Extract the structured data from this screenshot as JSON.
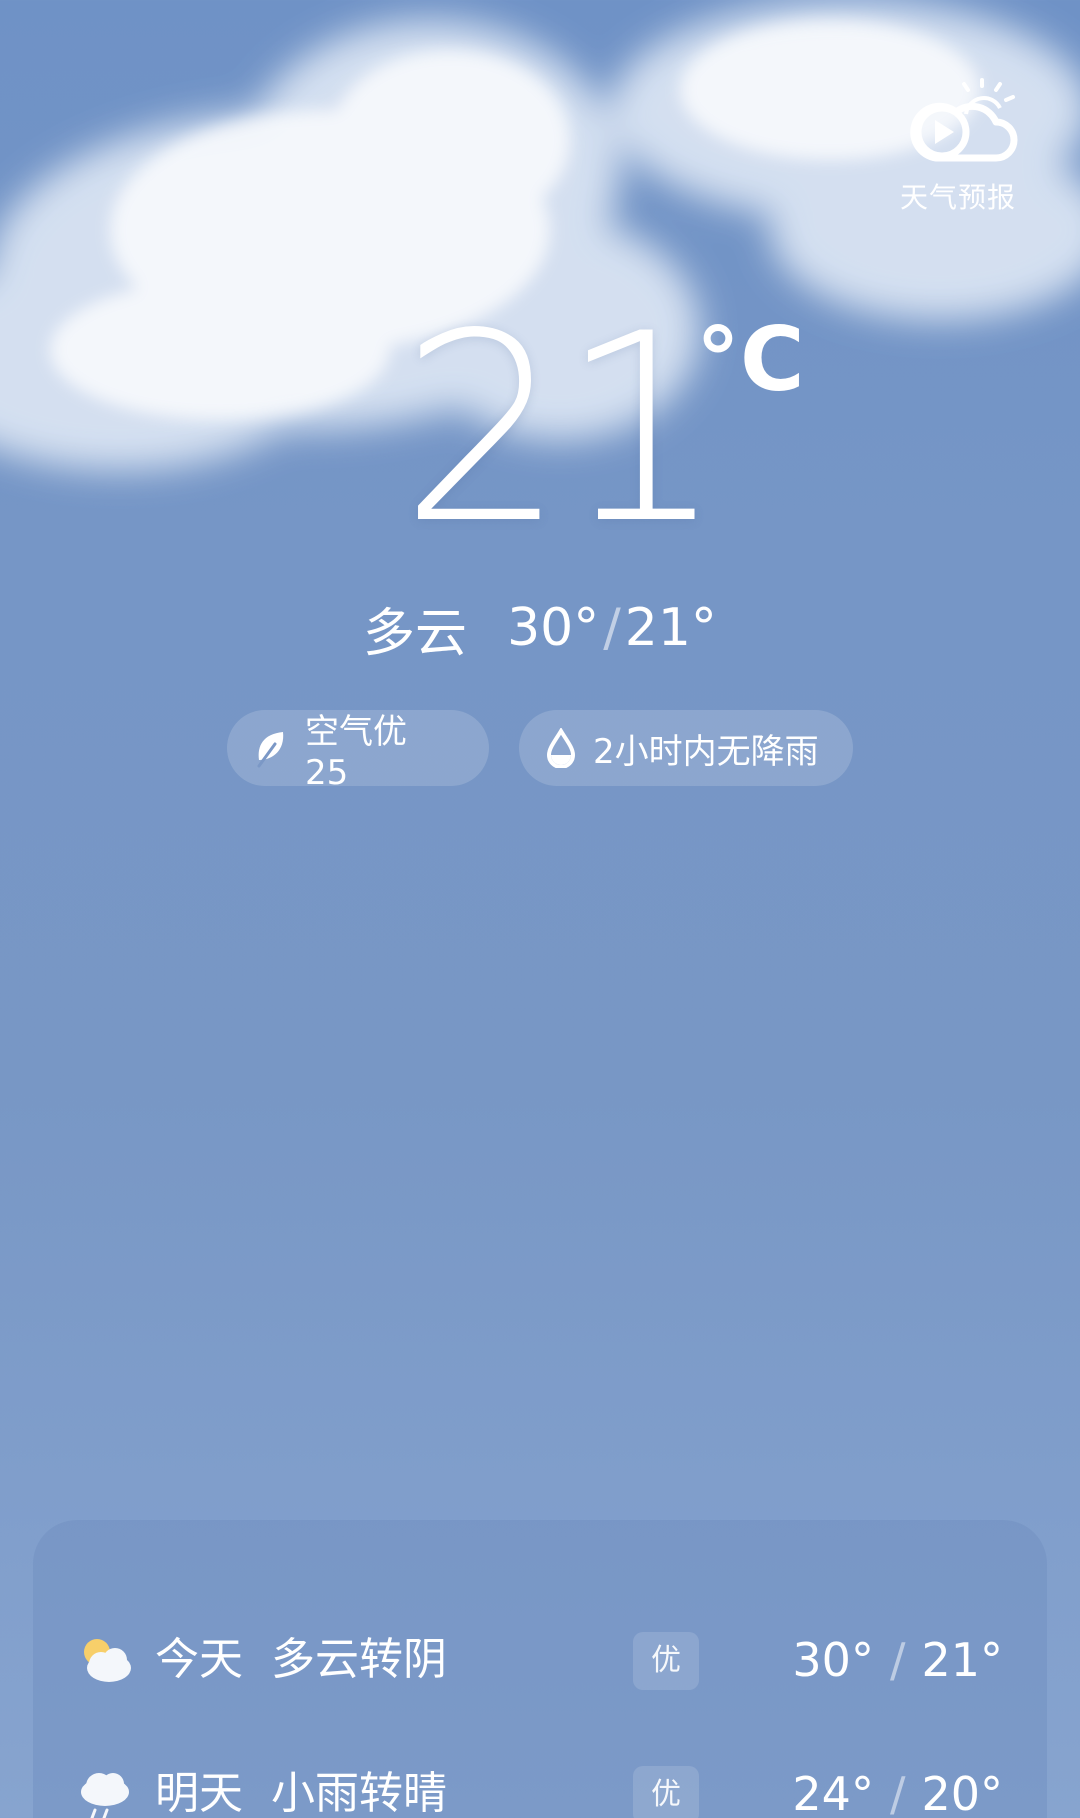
{
  "brand": {
    "label": "天气预报",
    "icon": "play-sun-cloud-icon"
  },
  "current": {
    "temp": "21",
    "unit": "°C",
    "condition": "多云",
    "high": "30°",
    "low": "21°"
  },
  "chips": {
    "air": {
      "icon": "leaf-icon",
      "text": "空气优 25"
    },
    "rain": {
      "icon": "water-drop-icon",
      "text": "2小时内无降雨"
    }
  },
  "forecast": [
    {
      "day": "今天",
      "desc": "多云转阴",
      "aqi": "优",
      "high": "30°",
      "low": "21°",
      "icon": "partly-cloudy-icon"
    },
    {
      "day": "明天",
      "desc": "小雨转晴",
      "aqi": "优",
      "high": "24°",
      "low": "20°",
      "icon": "light-rain-icon"
    }
  ]
}
